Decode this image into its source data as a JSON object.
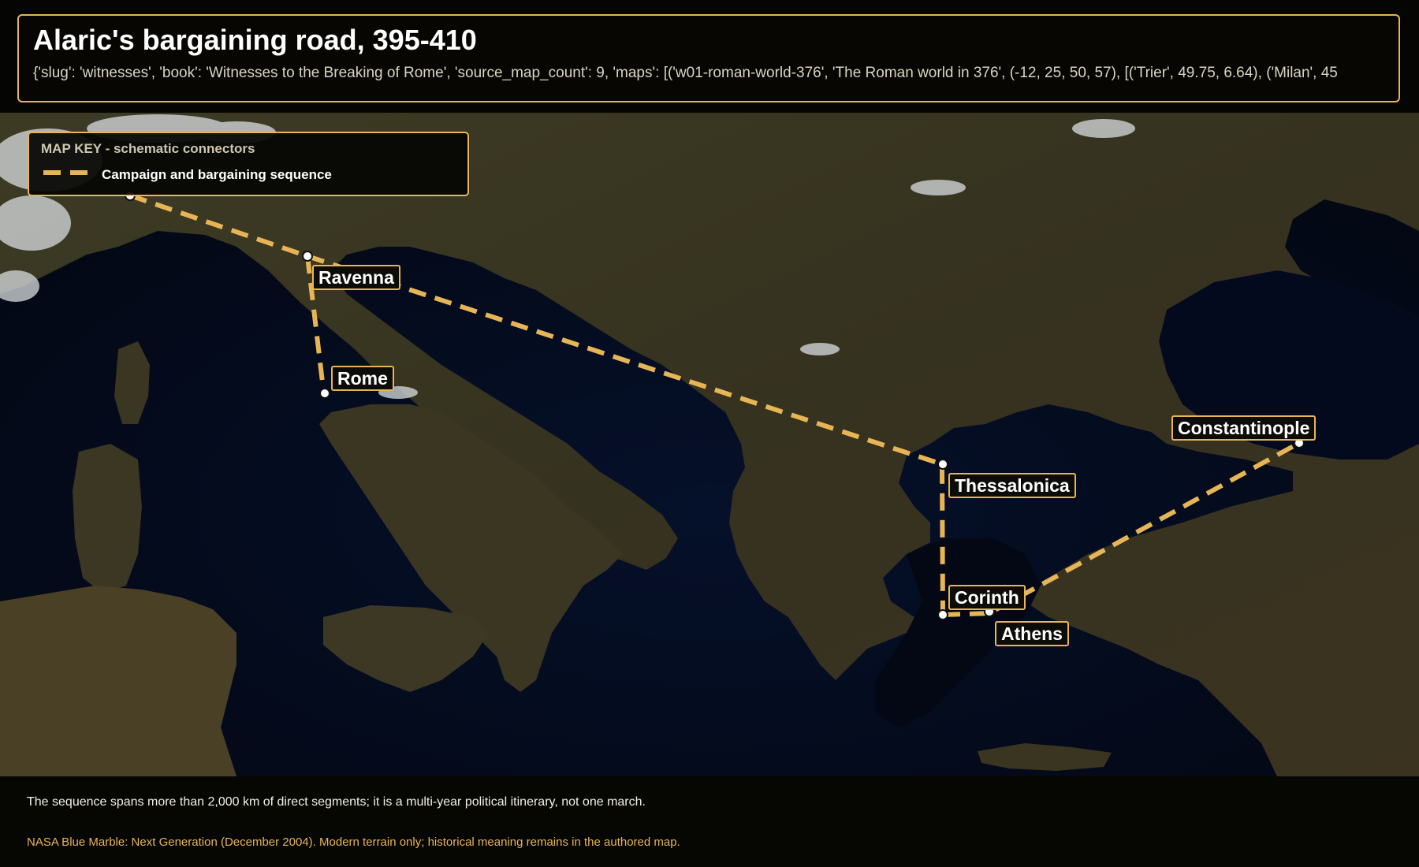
{
  "header": {
    "title": "Alaric's bargaining road, 395-410",
    "subtitle": "{'slug': 'witnesses', 'book': 'Witnesses to the Breaking of Rome', 'source_map_count': 9, 'maps': [('w01-roman-world-376', 'The Roman world in 376', (-12, 25, 50, 57), [('Trier', 49.75, 6.64), ('Milan', 45"
  },
  "legend": {
    "title": "MAP KEY - schematic connectors",
    "items": [
      {
        "label": "Campaign and bargaining sequence",
        "color": "#e7b555",
        "style": "dashed"
      }
    ]
  },
  "places": {
    "ravenna": "Ravenna",
    "rome": "Rome",
    "thessalonica": "Thessalonica",
    "constantinople": "Constantinople",
    "corinth": "Corinth",
    "athens": "Athens"
  },
  "route_color": "#e7b555",
  "footer": {
    "note": "The sequence spans more than 2,000 km of direct segments; it is a multi-year political itinerary, not one march.",
    "credit": "NASA Blue Marble: Next Generation (December 2004). Modern terrain only; historical meaning remains in the authored map."
  }
}
